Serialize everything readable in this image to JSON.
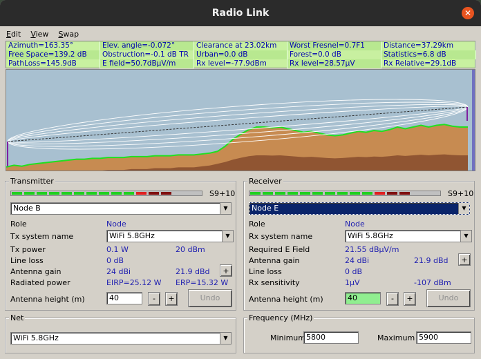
{
  "window": {
    "title": "Radio Link"
  },
  "menu": {
    "edit": "Edit",
    "view": "View",
    "swap": "Swap"
  },
  "stats": [
    "Azimuth=163.35°",
    "Elev. angle=-0.072°",
    "Clearance at 23.02km",
    "Worst Fresnel=0.7F1",
    "Distance=37.29km",
    "Free Space=139.2 dB",
    "Obstruction=-0.1 dB TR",
    "Urban=0.0 dB",
    "Forest=0.0 dB",
    "Statistics=6.8 dB",
    "PathLoss=145.9dB",
    "E field=50.7dBµV/m",
    "Rx level=-77.9dBm",
    "Rx level=28.57µV",
    "Rx Relative=29.1dB"
  ],
  "colors": {
    "stats_bg": "#c8f0a0",
    "sky": "#a8c0d0",
    "terrain_fill": "#c8884a",
    "terrain_dark": "#8a5030",
    "terrain_line": "#20e020",
    "meter_green": "#20d020",
    "meter_red": "#e02020",
    "meter_dark": "#801010"
  },
  "transmitter": {
    "legend": "Transmitter",
    "signal_label": "S9+10",
    "signal_segments": [
      "green",
      "green",
      "green",
      "green",
      "green",
      "green",
      "green",
      "green",
      "green",
      "green",
      "red",
      "dark",
      "dark"
    ],
    "node": "Node B",
    "role_label": "Role",
    "role_value": "Node",
    "system_label": "Tx system name",
    "system_value": "WiFi 5.8GHz",
    "power_label": "Tx power",
    "power_w": "0.1 W",
    "power_dbm": "20 dBm",
    "line_loss_label": "Line loss",
    "line_loss_value": "0 dB",
    "gain_label": "Antenna gain",
    "gain_dbi": "24 dBi",
    "gain_dbd": "21.9 dBd",
    "radiated_label": "Radiated power",
    "eirp": "EIRP=25.12 W",
    "erp": "ERP=15.32 W",
    "height_label": "Antenna height (m)",
    "height_value": "40",
    "minus": "-",
    "plus": "+",
    "undo": "Undo"
  },
  "receiver": {
    "legend": "Receiver",
    "signal_label": "S9+10",
    "signal_segments": [
      "green",
      "green",
      "green",
      "green",
      "green",
      "green",
      "green",
      "green",
      "green",
      "green",
      "red",
      "dark",
      "dark"
    ],
    "node": "Node E",
    "role_label": "Role",
    "role_value": "Node",
    "system_label": "Rx system name",
    "system_value": "WiFi 5.8GHz",
    "efield_label": "Required E Field",
    "efield_value": "21.55 dBµV/m",
    "gain_label": "Antenna gain",
    "gain_dbi": "24 dBi",
    "gain_dbd": "21.9 dBd",
    "line_loss_label": "Line loss",
    "line_loss_value": "0 dB",
    "sens_label": "Rx sensitivity",
    "sens_uv": "1µV",
    "sens_dbm": "-107 dBm",
    "height_label": "Antenna height (m)",
    "height_value": "40",
    "minus": "-",
    "plus": "+",
    "undo": "Undo"
  },
  "net": {
    "legend": "Net",
    "value": "WiFi 5.8GHz"
  },
  "frequency": {
    "legend": "Frequency (MHz)",
    "min_label": "Minimum",
    "min_value": "5800",
    "max_label": "Maximum",
    "max_value": "5900"
  },
  "terrain_profile": [
    0.04,
    0.06,
    0.05,
    0.07,
    0.08,
    0.09,
    0.1,
    0.11,
    0.12,
    0.13,
    0.13,
    0.14,
    0.14,
    0.15,
    0.15,
    0.15,
    0.16,
    0.16,
    0.16,
    0.17,
    0.17,
    0.17,
    0.18,
    0.18,
    0.18,
    0.19,
    0.2,
    0.22,
    0.28,
    0.36,
    0.42,
    0.47,
    0.5,
    0.5,
    0.49,
    0.5,
    0.48,
    0.46,
    0.44,
    0.45,
    0.43,
    0.41,
    0.4,
    0.41,
    0.43,
    0.45,
    0.44,
    0.46,
    0.45,
    0.47,
    0.5,
    0.48,
    0.5,
    0.52,
    0.5,
    0.52,
    0.53,
    0.51,
    0.5,
    0.5
  ]
}
